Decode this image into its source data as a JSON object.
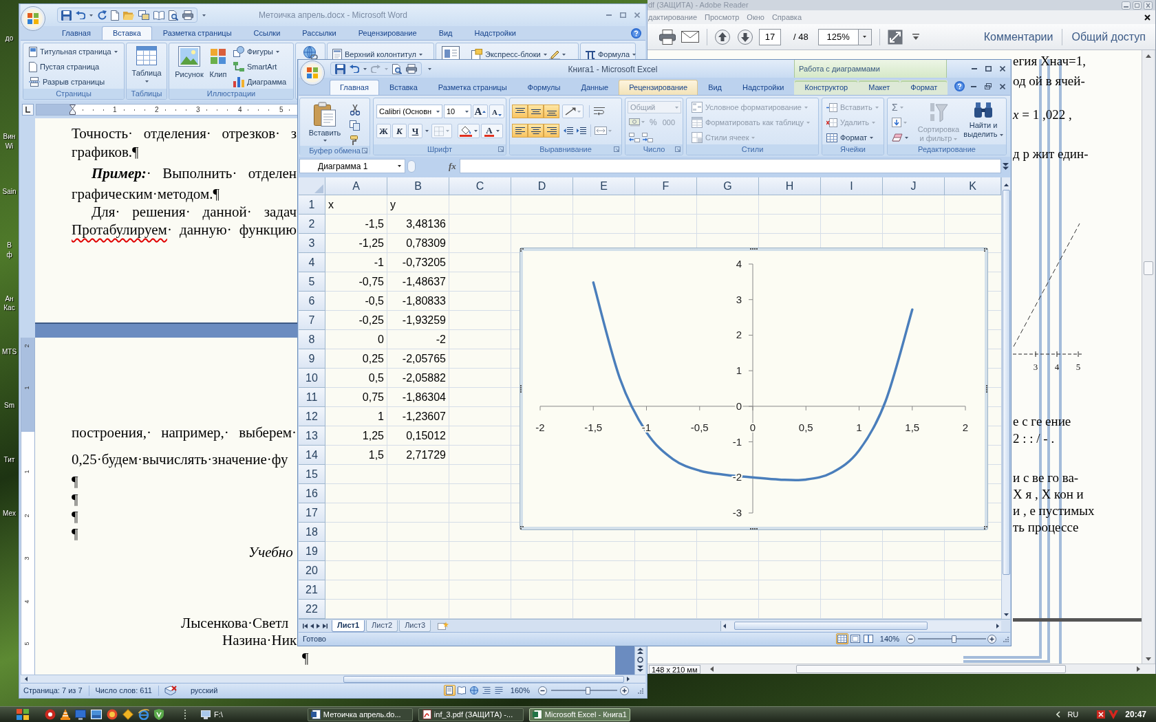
{
  "desktop": {
    "icons": [
      {
        "lines": [
          "до"
        ]
      },
      {
        "lines": [
          "Вин",
          "Wi"
        ]
      },
      {
        "lines": [
          "Sain"
        ]
      },
      {
        "lines": [
          "В",
          "ф"
        ]
      },
      {
        "lines": [
          "Ан",
          "Кас"
        ]
      },
      {
        "lines": [
          "MTS"
        ]
      },
      {
        "lines": [
          "Sm"
        ]
      },
      {
        "lines": [
          "Тит"
        ]
      },
      {
        "lines": [
          "Мех"
        ]
      }
    ]
  },
  "reader": {
    "title": "df (ЗАЩИТА) - Adobe Reader",
    "menu": [
      "дактирование",
      "Просмотр",
      "Окно",
      "Справка"
    ],
    "toolbar": {
      "page": "17",
      "page_count": "/ 48",
      "zoom": "125%",
      "buttons": [
        "Комментарии",
        "Общий доступ"
      ]
    },
    "page_lines": [
      "егия Хнач=1,",
      "од ой в ячей-",
      "*x* = 1 ,022 ,",
      "д р жит един-",
      "е с ге ение",
      "2 : : / - .",
      "и с ве го ва-",
      "Х я , Х кон и",
      "и , е пустимых",
      "ть процессе"
    ],
    "figure_labels": [
      "3",
      "4",
      "5"
    ],
    "page_size": "148 x 210 мм"
  },
  "word": {
    "title": "Метоичка апрель.docx - Microsoft Word",
    "tabs": [
      {
        "label": "Главная",
        "selected": false
      },
      {
        "label": "Вставка",
        "selected": true
      },
      {
        "label": "Разметка страницы",
        "selected": false
      },
      {
        "label": "Ссылки",
        "selected": false
      },
      {
        "label": "Рассылки",
        "selected": false
      },
      {
        "label": "Рецензирование",
        "selected": false
      },
      {
        "label": "Вид",
        "selected": false
      },
      {
        "label": "Надстройки",
        "selected": false
      }
    ],
    "ribbon": {
      "groups": [
        {
          "label": "Страницы",
          "items": [
            "Титульная страница",
            "Пустая страница",
            "Разрыв страницы"
          ]
        },
        {
          "label": "Таблицы",
          "items": [
            "Таблица"
          ]
        },
        {
          "label": "Иллюстрации",
          "items": [
            "Рисунок",
            "Клип",
            "Фигуры",
            "SmartArt",
            "Диаграмма"
          ]
        }
      ],
      "more_items": [
        "Верхний колонтитул",
        "Экспресс-блоки",
        "Формула"
      ]
    },
    "ruler_marks": [
      "1",
      "2",
      "3",
      "4",
      "5"
    ],
    "vertical_ruler_marks": [
      "2",
      "1",
      "1",
      "2",
      "3",
      "4",
      "5"
    ],
    "pages": [
      {
        "lines": [
          {
            "kind": "justified",
            "text": "Точность· отделения· отрезков· з",
            "spelling_error": false
          },
          {
            "kind": "plain",
            "text": "графиков.¶",
            "spelling_error": false
          },
          {
            "kind": "justified",
            "text": "**Пример:**· Выполнить· отделен",
            "spelling_error": false
          },
          {
            "kind": "plain",
            "text": "графическим·методом.¶",
            "spelling_error": false
          },
          {
            "kind": "justified",
            "text": "Для· решения· данной· задач",
            "spelling_error": false
          },
          {
            "kind": "justified",
            "text": "Протабулируем· данную· функцию",
            "spelling_error": true
          }
        ]
      },
      {
        "lines": [
          {
            "kind": "justified",
            "text": "построения,· например,· выберем·",
            "spelling_error": false
          },
          {
            "kind": "plain",
            "text": "0,25·будем·вычислять·значение·фу",
            "spelling_error": false
          },
          {
            "kind": "mark",
            "text": "¶",
            "spelling_error": false
          },
          {
            "kind": "mark",
            "text": "¶",
            "spelling_error": false
          },
          {
            "kind": "mark",
            "text": "¶",
            "spelling_error": false
          },
          {
            "kind": "mark",
            "text": "¶",
            "spelling_error": false
          },
          {
            "kind": "italic",
            "text": "Учебно",
            "spelling_error": false
          },
          {
            "kind": "plain",
            "text": "Лысенкова·Светл",
            "spelling_error": false
          },
          {
            "kind": "plain",
            "text": "Назина·Ник",
            "spelling_error": false
          },
          {
            "kind": "mark",
            "text": "¶",
            "spelling_error": false
          }
        ]
      }
    ],
    "status_bar": {
      "page": "Страница: 7 из 7",
      "words": "Число слов: 611",
      "language": "русский",
      "views": [
        {
          "selected": true
        },
        {
          "selected": false
        },
        {
          "selected": false
        },
        {
          "selected": false
        },
        {
          "selected": false
        }
      ],
      "zoom": "160%",
      "zoom_slider": {
        "level": 0.55
      }
    }
  },
  "excel": {
    "title": "Книга1 - Microsoft Excel",
    "context_title": "Работа с диаграммами",
    "tabs": [
      {
        "label": "Главная",
        "selected": true,
        "hovered": false,
        "contextual": false
      },
      {
        "label": "Вставка",
        "selected": false,
        "hovered": false,
        "contextual": false
      },
      {
        "label": "Разметка страницы",
        "selected": false,
        "hovered": false,
        "contextual": false
      },
      {
        "label": "Формулы",
        "selected": false,
        "hovered": false,
        "contextual": false
      },
      {
        "label": "Данные",
        "selected": false,
        "hovered": false,
        "contextual": false
      },
      {
        "label": "Рецензирование",
        "selected": false,
        "hovered": true,
        "contextual": false
      },
      {
        "label": "Вид",
        "selected": false,
        "hovered": false,
        "contextual": false
      },
      {
        "label": "Надстройки",
        "selected": false,
        "hovered": false,
        "contextual": false
      },
      {
        "label": "Конструктор",
        "selected": false,
        "hovered": false,
        "contextual": true
      },
      {
        "label": "Макет",
        "selected": false,
        "hovered": false,
        "contextual": true
      },
      {
        "label": "Формат",
        "selected": false,
        "hovered": false,
        "contextual": true
      }
    ],
    "ribbon": {
      "clipboard": {
        "label": "Буфер обмена",
        "paste": "Вставить"
      },
      "font": {
        "label": "Шрифт",
        "font_name": "Calibri (Основн",
        "font_size": "10",
        "grow": "A",
        "shrink": "A",
        "bold": "Ж",
        "italic": "К",
        "underline": "Ч",
        "color_letter": "A"
      },
      "alignment": {
        "label": "Выравнивание",
        "buttons": [
          {
            "selected": true
          },
          {
            "selected": true
          },
          {
            "selected": true
          },
          {
            "selected": true
          },
          {
            "selected": true
          },
          {
            "selected": true
          }
        ]
      },
      "number": {
        "label": "Число",
        "format": "Общий",
        "percent": "%",
        "thousands": "000",
        "disabled": true
      },
      "styles": {
        "label": "Стили",
        "items": [
          {
            "label": "Условное форматирование",
            "disabled": true
          },
          {
            "label": "Форматировать как таблицу",
            "disabled": true
          },
          {
            "label": "Стили ячеек",
            "disabled": true
          }
        ]
      },
      "cells": {
        "label": "Ячейки",
        "items": [
          {
            "label": "Вставить",
            "disabled": true
          },
          {
            "label": "Удалить",
            "disabled": true
          },
          {
            "label": "Формат",
            "disabled": false
          }
        ]
      },
      "editing": {
        "label": "Редактирование",
        "autosum": "Σ",
        "items": [
          {
            "label": "Сортировка и фильтр",
            "disabled": true
          },
          {
            "label": "Найти и выделить",
            "disabled": false
          }
        ]
      }
    },
    "name_box": "Диаграмма 1",
    "function_label": "fx",
    "columns": [
      "A",
      "B",
      "C",
      "D",
      "E",
      "F",
      "G",
      "H",
      "I",
      "J",
      "K"
    ],
    "rows": [
      {
        "number": "1",
        "kind": "text",
        "cells": [
          "x",
          "y"
        ]
      },
      {
        "number": "2",
        "kind": "number",
        "cells": [
          "-1,5",
          "3,48136"
        ]
      },
      {
        "number": "3",
        "kind": "number",
        "cells": [
          "-1,25",
          "0,78309"
        ]
      },
      {
        "number": "4",
        "kind": "number",
        "cells": [
          "-1",
          "-0,73205"
        ]
      },
      {
        "number": "5",
        "kind": "number",
        "cells": [
          "-0,75",
          "-1,48637"
        ]
      },
      {
        "number": "6",
        "kind": "number",
        "cells": [
          "-0,5",
          "-1,80833"
        ]
      },
      {
        "number": "7",
        "kind": "number",
        "cells": [
          "-0,25",
          "-1,93259"
        ]
      },
      {
        "number": "8",
        "kind": "number",
        "cells": [
          "0",
          "-2"
        ]
      },
      {
        "number": "9",
        "kind": "number",
        "cells": [
          "0,25",
          "-2,05765"
        ]
      },
      {
        "number": "10",
        "kind": "number",
        "cells": [
          "0,5",
          "-2,05882"
        ]
      },
      {
        "number": "11",
        "kind": "number",
        "cells": [
          "0,75",
          "-1,86304"
        ]
      },
      {
        "number": "12",
        "kind": "number",
        "cells": [
          "1",
          "-1,23607"
        ]
      },
      {
        "number": "13",
        "kind": "number",
        "cells": [
          "1,25",
          "0,15012"
        ]
      },
      {
        "number": "14",
        "kind": "number",
        "cells": [
          "1,5",
          "2,71729"
        ]
      },
      {
        "number": "15"
      },
      {
        "number": "16"
      },
      {
        "number": "17"
      },
      {
        "number": "18"
      },
      {
        "number": "19"
      },
      {
        "number": "20"
      },
      {
        "number": "21"
      },
      {
        "number": "22"
      }
    ],
    "chart": {
      "chart_data": {
        "type": "line",
        "x": [
          -1.5,
          -1.25,
          -1,
          -0.75,
          -0.5,
          -0.25,
          0,
          0.25,
          0.5,
          0.75,
          1,
          1.25,
          1.5
        ],
        "series": [
          {
            "color": "#4a7ebb",
            "values": [
              3.48,
              0.78,
              -0.73,
              -1.49,
              -1.81,
              -1.93,
              -2,
              -2.06,
              -2.06,
              -1.86,
              -1.24,
              0.15,
              2.72
            ]
          }
        ],
        "xlim": [
          -2,
          2
        ],
        "ylim": [
          -3,
          4
        ],
        "xticks": [
          -2,
          {
            "value": -1.5,
            "label": "-1,5"
          },
          -1,
          {
            "value": -0.5,
            "label": "-0,5"
          },
          0,
          {
            "value": 0.5,
            "label": "0,5"
          },
          1,
          {
            "value": 1.5,
            "label": "1,5"
          },
          2
        ],
        "yticks": [
          -3,
          -2,
          -1,
          0,
          1,
          2,
          3,
          4
        ]
      }
    },
    "sheet_tabs": [
      {
        "label": "Лист1",
        "selected": true
      },
      {
        "label": "Лист2",
        "selected": false
      },
      {
        "label": "Лист3",
        "selected": false
      }
    ],
    "status_bar": {
      "text": "Готово",
      "views": [
        {
          "selected": true
        },
        {
          "selected": false
        },
        {
          "selected": false
        }
      ],
      "zoom": "140%",
      "zoom_slider": {
        "level": 0.53
      }
    }
  },
  "taskbar": {
    "toolbar_label": "F:\\",
    "tasks": [
      {
        "kind": "document",
        "label": "Метоичка апрель.do...",
        "selected": false
      },
      {
        "kind": "pdf",
        "label": "inf_3.pdf (ЗАЩИТА) -...",
        "selected": false
      },
      {
        "kind": "spreadsheet",
        "label": "Microsoft Excel - Книга1",
        "selected": true
      }
    ],
    "language": "RU",
    "clock": "20:47"
  }
}
